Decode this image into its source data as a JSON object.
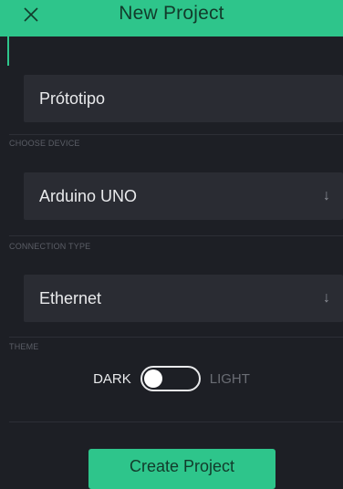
{
  "header": {
    "title": "New Project",
    "close_icon": "close-icon"
  },
  "project_name": {
    "value": "Prótotipo"
  },
  "device": {
    "section_label": "CHOOSE DEVICE",
    "selected": "Arduino UNO",
    "icon": "arrow-down-icon"
  },
  "connection": {
    "section_label": "CONNECTION TYPE",
    "selected": "Ethernet",
    "icon": "arrow-down-icon"
  },
  "theme": {
    "section_label": "THEME",
    "dark_label": "DARK",
    "light_label": "LIGHT",
    "selected": "DARK"
  },
  "actions": {
    "create_label": "Create Project"
  },
  "colors": {
    "accent": "#2ec58b",
    "background": "#1d1f25",
    "field": "#2a2c33"
  }
}
